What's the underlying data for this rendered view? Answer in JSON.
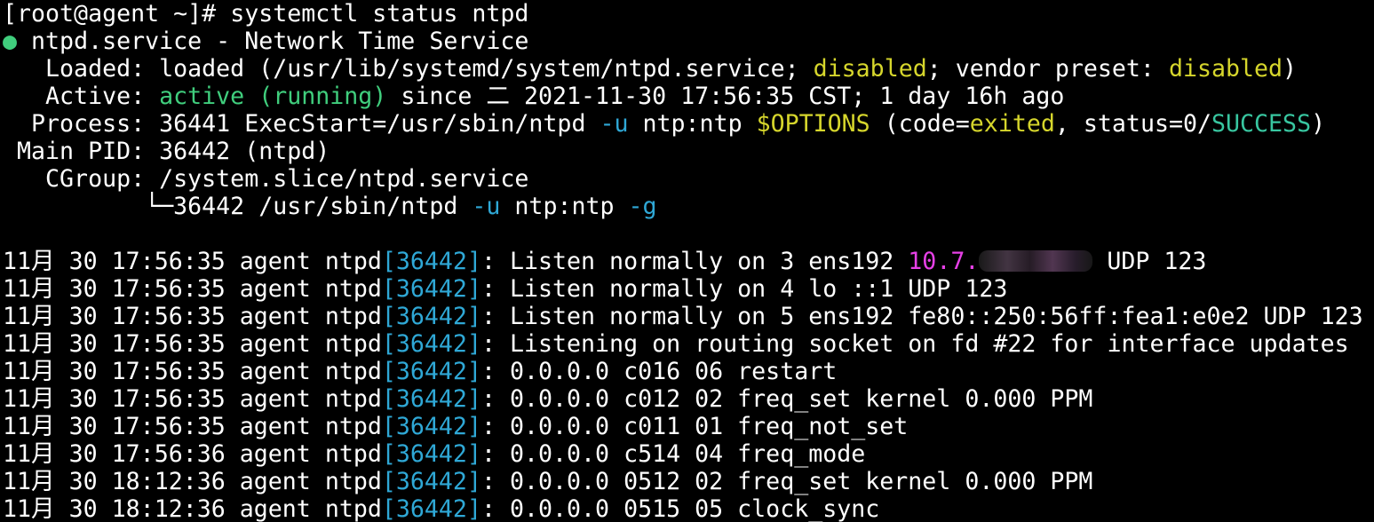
{
  "terminal": {
    "prompt": "[root@agent ~]#",
    "command": "systemctl status ntpd",
    "status_dot": "●",
    "service_header": "ntpd.service - Network Time Service",
    "loaded": {
      "label": "   Loaded:",
      "prefix": "loaded (/usr/lib/systemd/system/ntpd.service;",
      "state": "disabled",
      "mid": "; vendor preset:",
      "preset": "disabled",
      "suffix": ")"
    },
    "active": {
      "label": "   Active:",
      "state": "active (running)",
      "since": "since 二 2021-11-30 17:56:35 CST; 1 day 16h ago"
    },
    "process": {
      "label": "  Process:",
      "pre": "36441 ExecStart=/usr/sbin/ntpd",
      "flag": "-u",
      "mid": "ntp:ntp",
      "var": "$OPTIONS",
      "code_open": "(code=",
      "code": "exited",
      "status_text": ", status=0/",
      "status": "SUCCESS",
      "close": ")"
    },
    "main_pid": {
      "label": " Main PID:",
      "value": "36442 (ntpd)"
    },
    "cgroup": {
      "label": "   CGroup:",
      "value": "/system.slice/ntpd.service",
      "tree": "          └─36442 /usr/sbin/ntpd",
      "flag1": "-u",
      "user": "ntp:ntp",
      "flag2": "-g"
    },
    "log_lines": [
      {
        "ts": "11月 30 17:56:35 agent ntpd",
        "pid": "[36442]",
        "msg": "Listen normally on 3 ens192",
        "ip": "10.7.",
        "after": " UDP 123"
      },
      {
        "ts": "11月 30 17:56:35 agent ntpd",
        "pid": "[36442]",
        "msg": "Listen normally on 4 lo ::1 UDP 123"
      },
      {
        "ts": "11月 30 17:56:35 agent ntpd",
        "pid": "[36442]",
        "msg": "Listen normally on 5 ens192 fe80::250:56ff:fea1:e0e2 UDP 123"
      },
      {
        "ts": "11月 30 17:56:35 agent ntpd",
        "pid": "[36442]",
        "msg": "Listening on routing socket on fd #22 for interface updates"
      },
      {
        "ts": "11月 30 17:56:35 agent ntpd",
        "pid": "[36442]",
        "msg": "0.0.0.0 c016 06 restart"
      },
      {
        "ts": "11月 30 17:56:35 agent ntpd",
        "pid": "[36442]",
        "msg": "0.0.0.0 c012 02 freq_set kernel 0.000 PPM"
      },
      {
        "ts": "11月 30 17:56:35 agent ntpd",
        "pid": "[36442]",
        "msg": "0.0.0.0 c011 01 freq_not_set"
      },
      {
        "ts": "11月 30 17:56:36 agent ntpd",
        "pid": "[36442]",
        "msg": "0.0.0.0 c514 04 freq_mode"
      },
      {
        "ts": "11月 30 18:12:36 agent ntpd",
        "pid": "[36442]",
        "msg": "0.0.0.0 0512 02 freq_set kernel 0.000 PPM"
      },
      {
        "ts": "11月 30 18:12:36 agent ntpd",
        "pid": "[36442]",
        "msg": "0.0.0.0 0515 05 clock_sync"
      }
    ],
    "colors": {
      "background": "#000000",
      "text": "#ffffff",
      "green": "#40ce7d",
      "yellow": "#d6d62c",
      "cyan": "#2fa8d6",
      "teal": "#38c6a0",
      "magenta": "#e640e6"
    }
  }
}
